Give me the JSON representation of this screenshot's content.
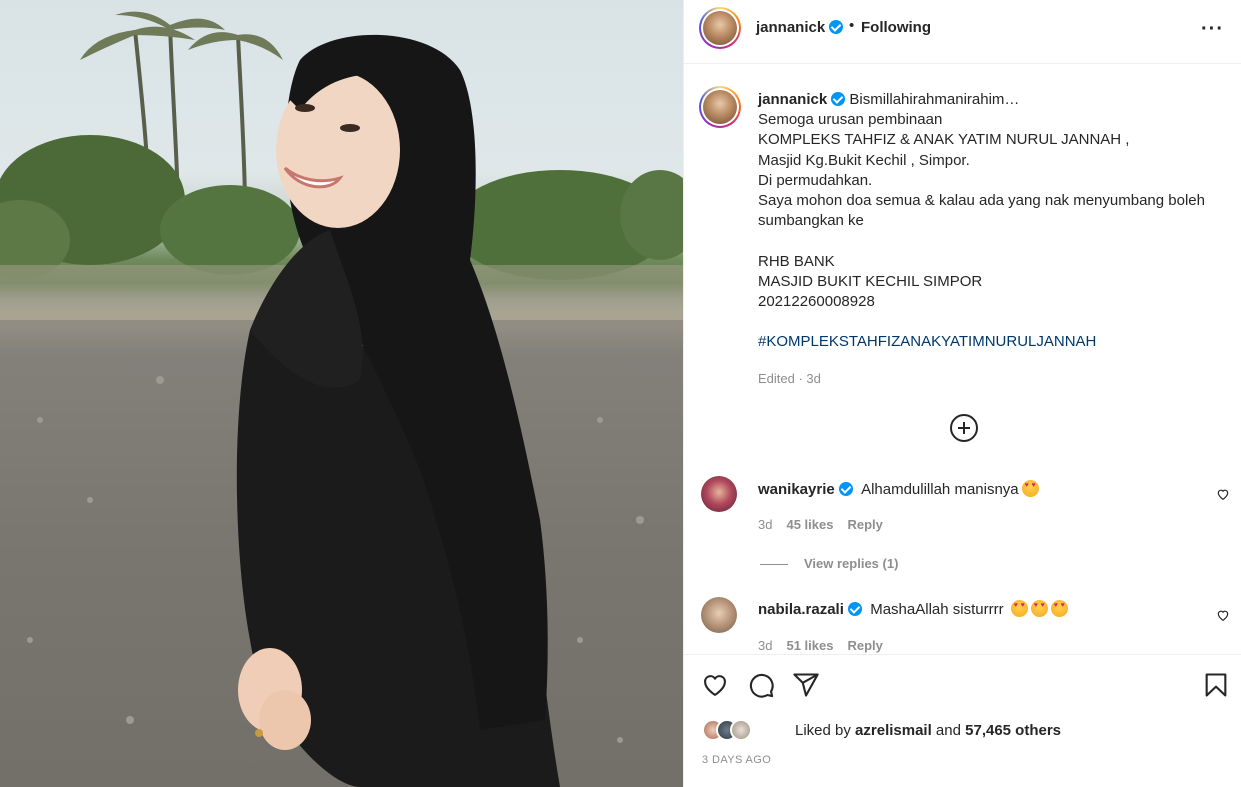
{
  "post": {
    "photo_alt": "",
    "author": "jannanick",
    "follow_status": "Following",
    "more_icon": "more-horizontal-icon"
  },
  "caption": {
    "user": "jannanick",
    "lines": [
      "Bismillahirahmanirahim…",
      "Semoga urusan pembinaan",
      "KOMPLEKS TAHFIZ & ANAK YATIM NURUL JANNAH ,",
      "Masjid Kg.Bukit Kechil , Simpor.",
      "Di permudahkan.",
      "Saya mohon doa semua & kalau ada yang nak menyumbang boleh",
      "sumbangkan ke",
      "",
      "RHB BANK",
      "MASJID BUKIT KECHIL SIMPOR",
      "20212260008928",
      ""
    ],
    "hashtag": "#KOMPLEKSTAHFIZANAKYATIMNURULJANNAH",
    "edited": "Edited · 3d"
  },
  "comments": [
    {
      "user": "wanikayrie",
      "text": "Alhamdulillah manisnya",
      "emoji_count": 1,
      "time": "3d",
      "likes": "45 likes",
      "reply": "Reply",
      "view_replies": "View replies (1)"
    },
    {
      "user": "nabila.razali",
      "text": "MashaAllah sisturrrr ",
      "emoji_count": 3,
      "time": "3d",
      "likes": "51 likes",
      "reply": "Reply"
    }
  ],
  "actions": {
    "like_icon": "heart-icon",
    "comment_icon": "comment-icon",
    "share_icon": "share-icon",
    "save_icon": "bookmark-icon"
  },
  "likes": {
    "prefix": "Liked by ",
    "user": "azrelismail",
    "middle": " and ",
    "others": "57,465 others"
  },
  "timestamp": "3 DAYS AGO",
  "colors": {
    "verified": "#0095f6",
    "hashtag": "#00376b",
    "muted": "#8e8e8e",
    "text": "#262626"
  }
}
